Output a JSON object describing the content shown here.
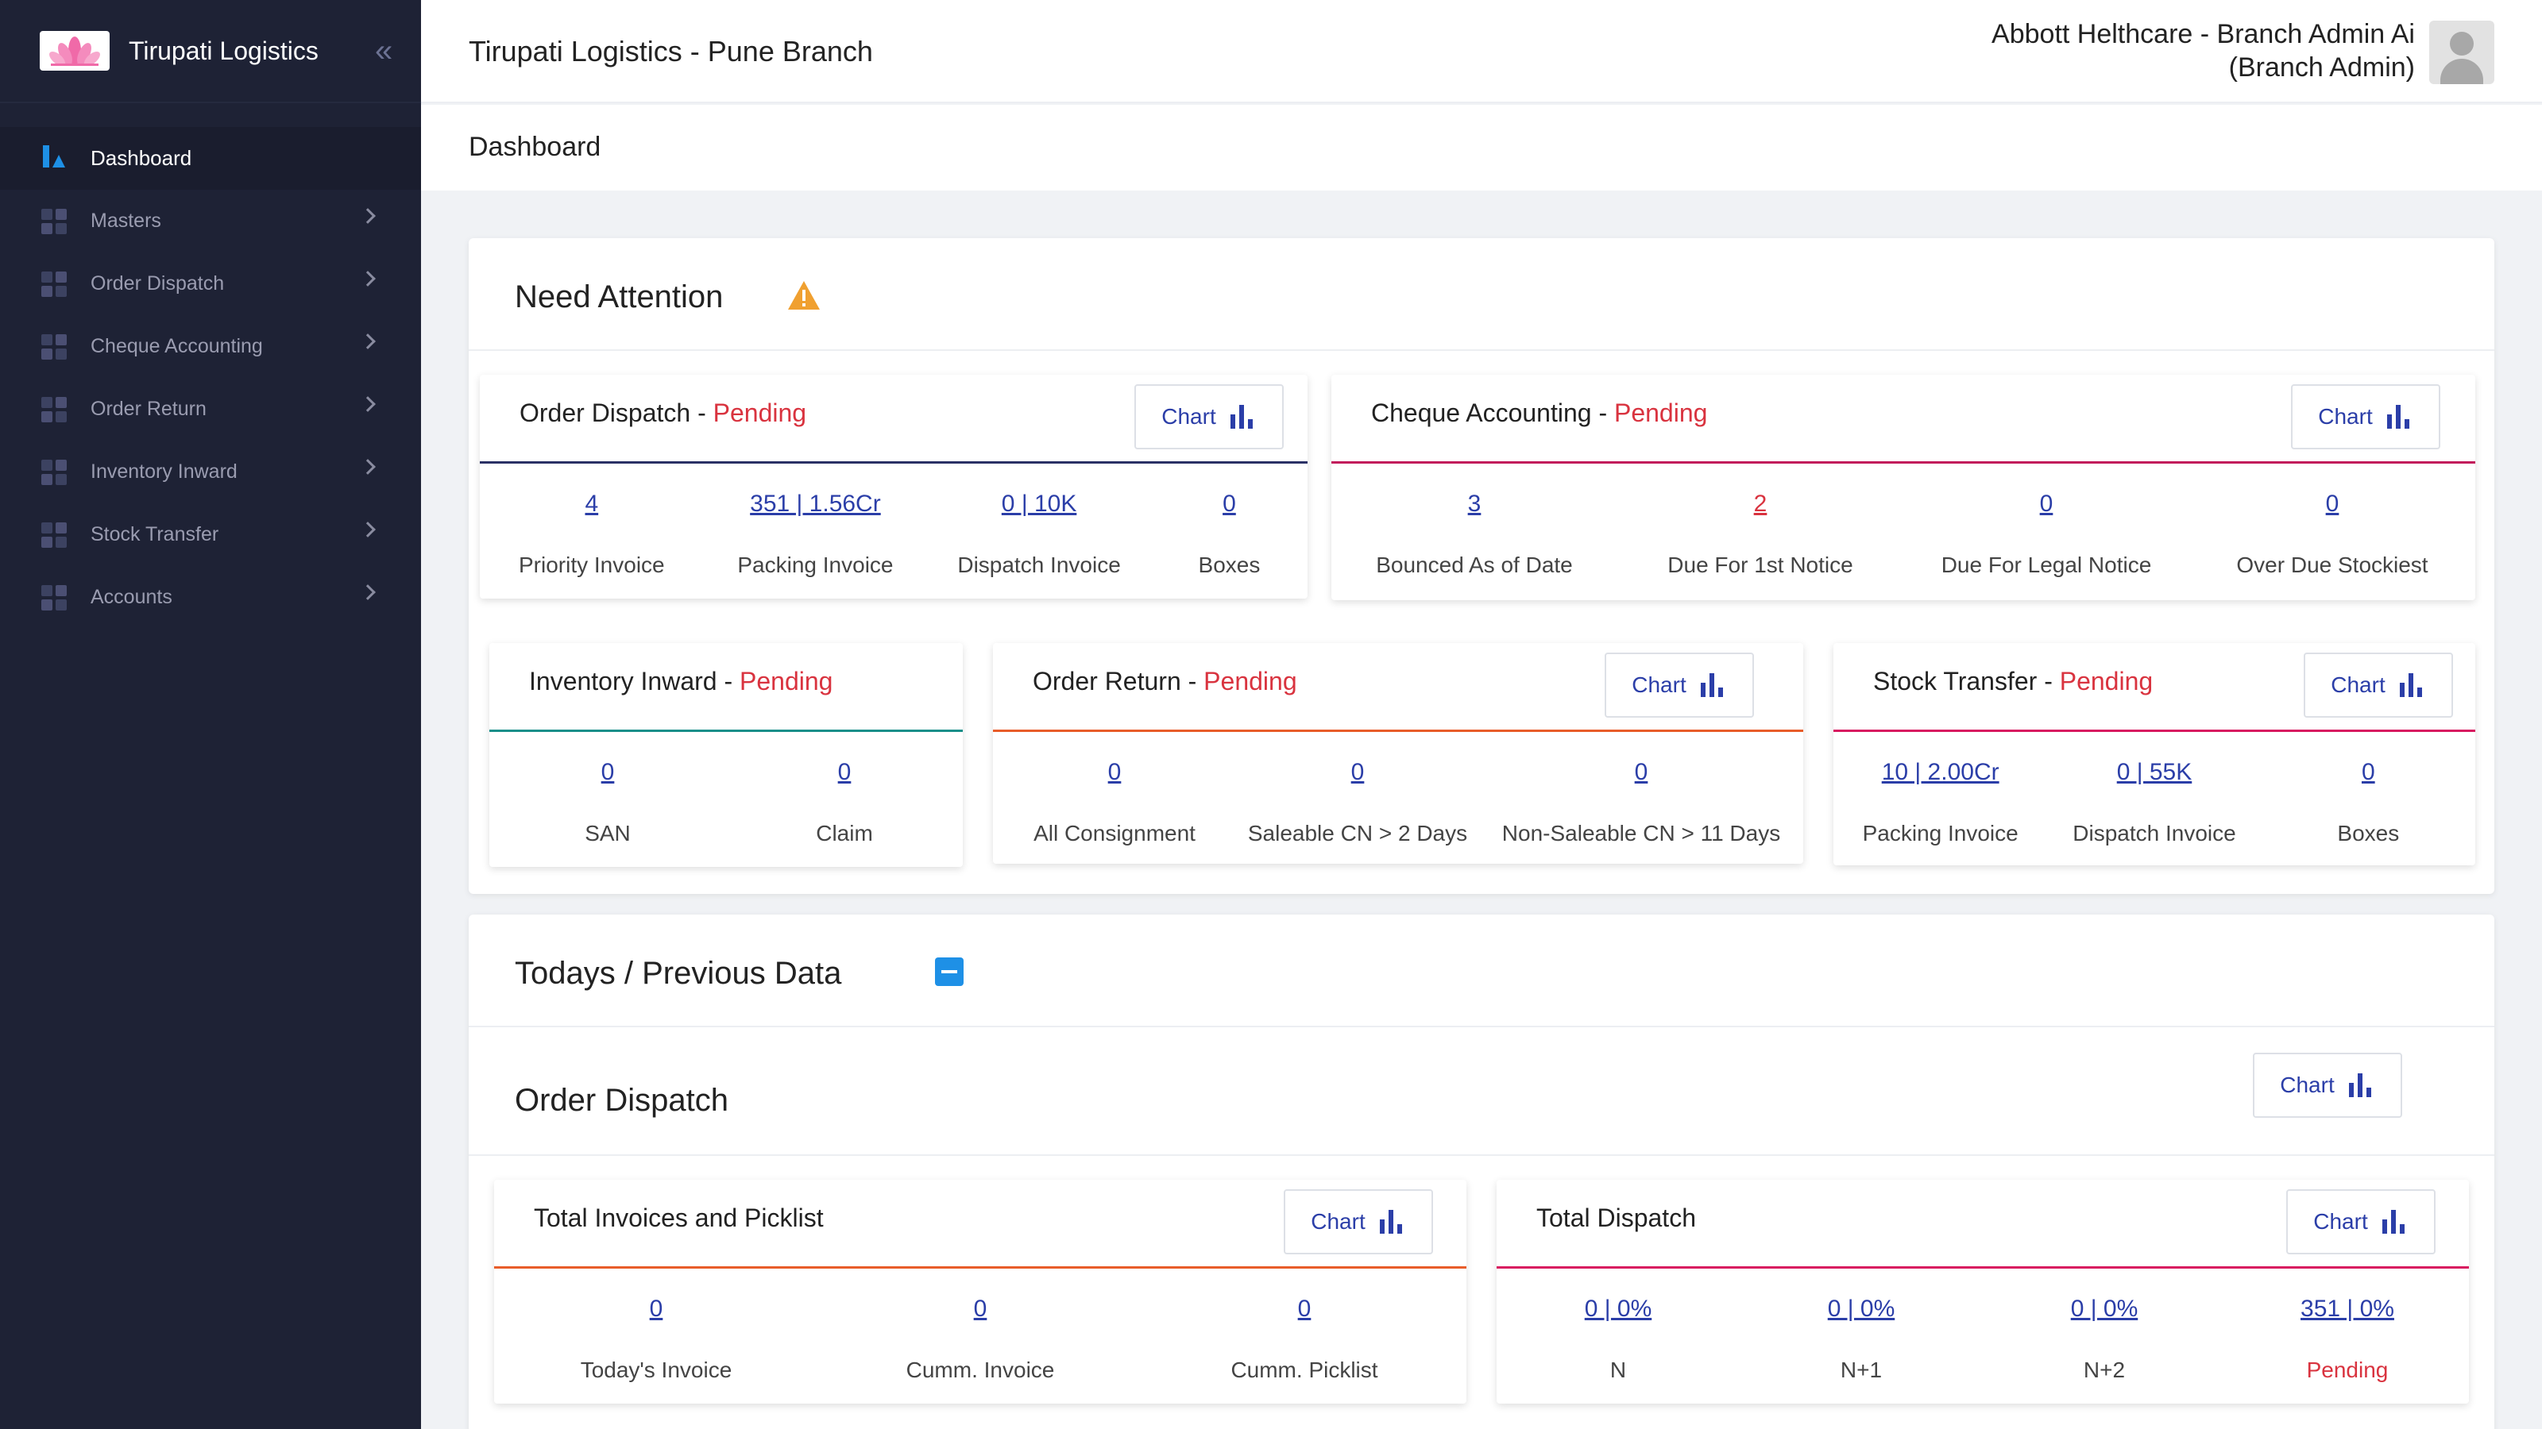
{
  "sidebar": {
    "brand": "Tirupati Logistics",
    "items": [
      {
        "label": "Dashboard",
        "active": true
      },
      {
        "label": "Masters"
      },
      {
        "label": "Order Dispatch"
      },
      {
        "label": "Cheque Accounting"
      },
      {
        "label": "Order Return"
      },
      {
        "label": "Inventory Inward"
      },
      {
        "label": "Stock Transfer"
      },
      {
        "label": "Accounts"
      }
    ]
  },
  "header": {
    "branch_title": "Tirupati Logistics - Pune Branch",
    "user_name": "Abbott Helthcare - Branch Admin Ai",
    "user_role": "(Branch Admin)"
  },
  "subheader": {
    "title": "Dashboard"
  },
  "colors": {
    "accent": "#1e90e6",
    "pending": "#d9333f",
    "link": "#2b3ea8",
    "sidebar": "#1e2235",
    "warning": "#f0a030"
  },
  "need_attention": {
    "title": "Need Attention",
    "chart_label": "Chart",
    "pending_label": "Pending",
    "order_dispatch": {
      "title": "Order Dispatch - ",
      "metrics": [
        {
          "value": "4",
          "label": "Priority Invoice"
        },
        {
          "value": "351 | 1.56Cr",
          "label": "Packing Invoice"
        },
        {
          "value": "0 | 10K",
          "label": "Dispatch Invoice"
        },
        {
          "value": "0",
          "label": "Boxes"
        }
      ]
    },
    "cheque_accounting": {
      "title": "Cheque Accounting - ",
      "metrics": [
        {
          "value": "3",
          "label": "Bounced As of Date"
        },
        {
          "value": "2",
          "label": "Due For 1st Notice"
        },
        {
          "value": "0",
          "label": "Due For Legal Notice"
        },
        {
          "value": "0",
          "label": "Over Due Stockiest"
        }
      ]
    },
    "inventory_inward": {
      "title": "Inventory Inward - ",
      "metrics": [
        {
          "value": "0",
          "label": "SAN"
        },
        {
          "value": "0",
          "label": "Claim"
        }
      ]
    },
    "order_return": {
      "title": "Order Return - ",
      "metrics": [
        {
          "value": "0",
          "label": "All Consignment"
        },
        {
          "value": "0",
          "label": "Saleable CN > 2 Days"
        },
        {
          "value": "0",
          "label": "Non-Saleable CN > 11 Days"
        }
      ]
    },
    "stock_transfer": {
      "title": "Stock Transfer - ",
      "metrics": [
        {
          "value": "10 | 2.00Cr",
          "label": "Packing Invoice"
        },
        {
          "value": "0 | 55K",
          "label": "Dispatch Invoice"
        },
        {
          "value": "0",
          "label": "Boxes"
        }
      ]
    }
  },
  "todays_data": {
    "title": "Todays / Previous Data",
    "order_dispatch_title": "Order Dispatch",
    "chart_label": "Chart",
    "total_invoices": {
      "title": "Total Invoices and Picklist",
      "metrics": [
        {
          "value": "0",
          "label": "Today's Invoice"
        },
        {
          "value": "0",
          "label": "Cumm. Invoice"
        },
        {
          "value": "0",
          "label": "Cumm. Picklist"
        }
      ]
    },
    "total_dispatch": {
      "title": "Total Dispatch",
      "metrics": [
        {
          "value": "0 | 0%",
          "label": "N"
        },
        {
          "value": "0 | 0%",
          "label": "N+1"
        },
        {
          "value": "0 | 0%",
          "label": "N+2"
        },
        {
          "value": "351 | 0%",
          "label": "Pending"
        }
      ]
    }
  }
}
